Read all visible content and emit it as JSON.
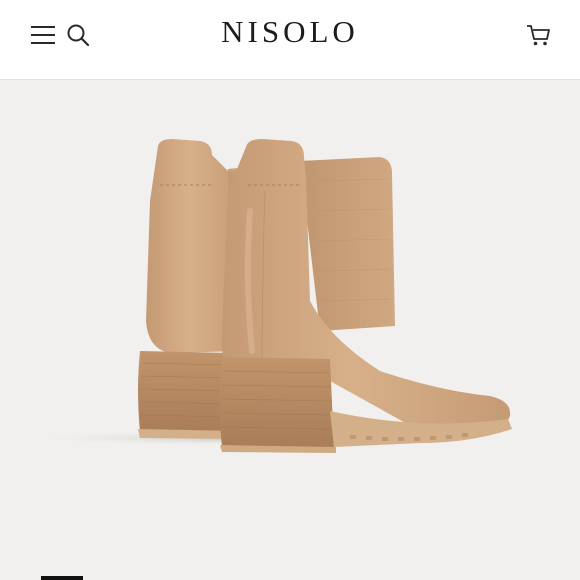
{
  "header": {
    "brand": "NISOLO",
    "icons": {
      "menu": "hamburger-menu-icon",
      "search": "search-icon",
      "cart": "shopping-cart-icon"
    }
  },
  "product": {
    "image": "tan-leather-chelsea-boots",
    "colors": {
      "leather": "#cfa57f",
      "elastic": "#c8a07a",
      "heel": "#b88a63",
      "sole": "#d3b089"
    }
  },
  "gallery": {
    "active_index": 0
  }
}
